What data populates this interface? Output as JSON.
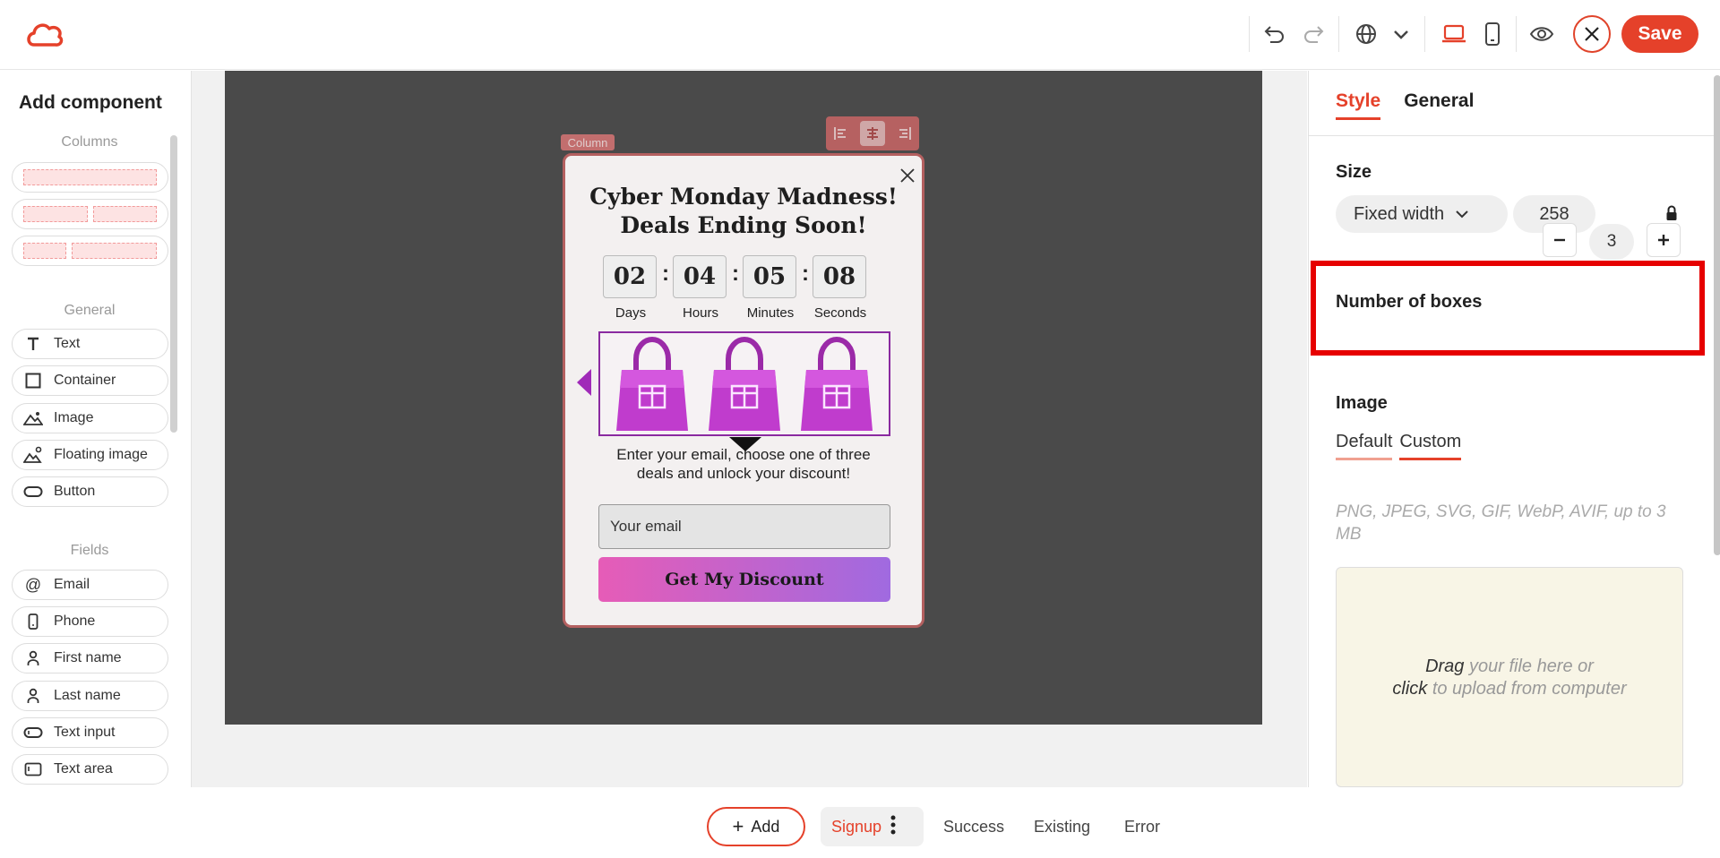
{
  "header": {
    "save_label": "Save"
  },
  "left_panel": {
    "title": "Add component",
    "columns_section": "Columns",
    "general_section": "General",
    "general_items": [
      "Text",
      "Container",
      "Image",
      "Floating image",
      "Button"
    ],
    "fields_section": "Fields",
    "field_items": [
      "Email",
      "Phone",
      "First name",
      "Last name",
      "Text input",
      "Text area"
    ]
  },
  "canvas": {
    "column_badge": "Column",
    "popup": {
      "title_line1": "Cyber Monday Madness!",
      "title_line2": "Deals Ending Soon!",
      "timer": [
        {
          "value": "02",
          "label": "Days"
        },
        {
          "value": "04",
          "label": "Hours"
        },
        {
          "value": "05",
          "label": "Minutes"
        },
        {
          "value": "08",
          "label": "Seconds"
        }
      ],
      "body_line1": "Enter your email, choose one of three",
      "body_line2": "deals and unlock your discount!",
      "email_placeholder": "Your email",
      "cta_label": "Get My Discount"
    }
  },
  "bottom_bar": {
    "add_label": "Add",
    "steps": [
      "Signup",
      "Success",
      "Existing",
      "Error"
    ],
    "active_step": "Signup"
  },
  "right_panel": {
    "tabs": [
      "Style",
      "General"
    ],
    "active_tab": "Style",
    "size_label": "Size",
    "size_mode": "Fixed width",
    "size_value": "258",
    "boxes_label": "Number of boxes",
    "boxes_value": "3",
    "image_label": "Image",
    "image_tabs": [
      "Default",
      "Custom"
    ],
    "active_image_tab": "Custom",
    "file_hint": "PNG, JPEG, SVG, GIF, WebP, AVIF, up to 3 MB",
    "drop_drag": "Drag",
    "drop_rest1": " your file here or",
    "drop_click": "click",
    "drop_rest2": " to upload from computer"
  },
  "colors": {
    "accent": "#e5412a",
    "highlight": "#e60000",
    "canvas_bg": "#4a4a4a",
    "cta_gradient_start": "#e65cb7",
    "cta_gradient_end": "#a06ae0"
  }
}
